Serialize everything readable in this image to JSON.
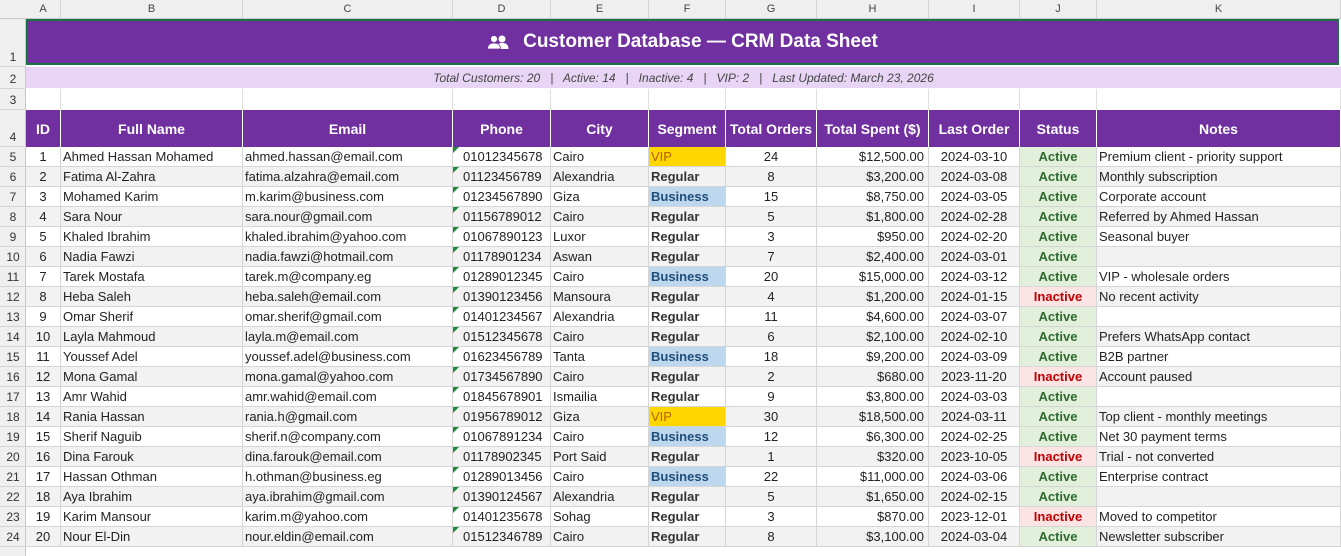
{
  "columns": [
    "A",
    "B",
    "C",
    "D",
    "E",
    "F",
    "G",
    "H",
    "I",
    "J",
    "K"
  ],
  "rows": [
    "1",
    "2",
    "3",
    "4",
    "5",
    "6",
    "7",
    "8",
    "9",
    "10",
    "11",
    "12",
    "13",
    "14",
    "15",
    "16",
    "17",
    "18",
    "19",
    "20",
    "21",
    "22",
    "23",
    "24"
  ],
  "title": "Customer Database — CRM Data Sheet",
  "title_icon": "users-icon",
  "subtitle": "Total Customers: 20   |   Active: 14   |   Inactive: 4   |   VIP: 2   |   Last Updated: March 23, 2026",
  "headers": [
    "ID",
    "Full Name",
    "Email",
    "Phone",
    "City",
    "Segment",
    "Total Orders",
    "Total Spent ($)",
    "Last Order",
    "Status",
    "Notes"
  ],
  "customers": [
    [
      "1",
      "Ahmed Hassan Mohamed",
      "ahmed.hassan@email.com",
      "01012345678",
      "Cairo",
      "VIP",
      "24",
      "$12,500.00",
      "2024-03-10",
      "Active",
      "Premium client - priority support"
    ],
    [
      "2",
      "Fatima Al-Zahra",
      "fatima.alzahra@email.com",
      "01123456789",
      "Alexandria",
      "Regular",
      "8",
      "$3,200.00",
      "2024-03-08",
      "Active",
      "Monthly subscription"
    ],
    [
      "3",
      "Mohamed Karim",
      "m.karim@business.com",
      "01234567890",
      "Giza",
      "Business",
      "15",
      "$8,750.00",
      "2024-03-05",
      "Active",
      "Corporate account"
    ],
    [
      "4",
      "Sara Nour",
      "sara.nour@gmail.com",
      "01156789012",
      "Cairo",
      "Regular",
      "5",
      "$1,800.00",
      "2024-02-28",
      "Active",
      "Referred by Ahmed Hassan"
    ],
    [
      "5",
      "Khaled Ibrahim",
      "khaled.ibrahim@yahoo.com",
      "01067890123",
      "Luxor",
      "Regular",
      "3",
      "$950.00",
      "2024-02-20",
      "Active",
      "Seasonal buyer"
    ],
    [
      "6",
      "Nadia Fawzi",
      "nadia.fawzi@hotmail.com",
      "01178901234",
      "Aswan",
      "Regular",
      "7",
      "$2,400.00",
      "2024-03-01",
      "Active",
      ""
    ],
    [
      "7",
      "Tarek Mostafa",
      "tarek.m@company.eg",
      "01289012345",
      "Cairo",
      "Business",
      "20",
      "$15,000.00",
      "2024-03-12",
      "Active",
      "VIP - wholesale orders"
    ],
    [
      "8",
      "Heba Saleh",
      "heba.saleh@email.com",
      "01390123456",
      "Mansoura",
      "Regular",
      "4",
      "$1,200.00",
      "2024-01-15",
      "Inactive",
      "No recent activity"
    ],
    [
      "9",
      "Omar Sherif",
      "omar.sherif@gmail.com",
      "01401234567",
      "Alexandria",
      "Regular",
      "11",
      "$4,600.00",
      "2024-03-07",
      "Active",
      ""
    ],
    [
      "10",
      "Layla Mahmoud",
      "layla.m@email.com",
      "01512345678",
      "Cairo",
      "Regular",
      "6",
      "$2,100.00",
      "2024-02-10",
      "Active",
      "Prefers WhatsApp contact"
    ],
    [
      "11",
      "Youssef Adel",
      "youssef.adel@business.com",
      "01623456789",
      "Tanta",
      "Business",
      "18",
      "$9,200.00",
      "2024-03-09",
      "Active",
      "B2B partner"
    ],
    [
      "12",
      "Mona Gamal",
      "mona.gamal@yahoo.com",
      "01734567890",
      "Cairo",
      "Regular",
      "2",
      "$680.00",
      "2023-11-20",
      "Inactive",
      "Account paused"
    ],
    [
      "13",
      "Amr Wahid",
      "amr.wahid@email.com",
      "01845678901",
      "Ismailia",
      "Regular",
      "9",
      "$3,800.00",
      "2024-03-03",
      "Active",
      ""
    ],
    [
      "14",
      "Rania Hassan",
      "rania.h@gmail.com",
      "01956789012",
      "Giza",
      "VIP",
      "30",
      "$18,500.00",
      "2024-03-11",
      "Active",
      "Top client - monthly meetings"
    ],
    [
      "15",
      "Sherif Naguib",
      "sherif.n@company.com",
      "01067891234",
      "Cairo",
      "Business",
      "12",
      "$6,300.00",
      "2024-02-25",
      "Active",
      "Net 30 payment terms"
    ],
    [
      "16",
      "Dina Farouk",
      "dina.farouk@email.com",
      "01178902345",
      "Port Said",
      "Regular",
      "1",
      "$320.00",
      "2023-10-05",
      "Inactive",
      "Trial - not converted"
    ],
    [
      "17",
      "Hassan Othman",
      "h.othman@business.eg",
      "01289013456",
      "Cairo",
      "Business",
      "22",
      "$11,000.00",
      "2024-03-06",
      "Active",
      "Enterprise contract"
    ],
    [
      "18",
      "Aya Ibrahim",
      "aya.ibrahim@gmail.com",
      "01390124567",
      "Alexandria",
      "Regular",
      "5",
      "$1,650.00",
      "2024-02-15",
      "Active",
      ""
    ],
    [
      "19",
      "Karim Mansour",
      "karim.m@yahoo.com",
      "01401235678",
      "Sohag",
      "Regular",
      "3",
      "$870.00",
      "2023-12-01",
      "Inactive",
      "Moved to competitor"
    ],
    [
      "20",
      "Nour El-Din",
      "nour.eldin@email.com",
      "01512346789",
      "Cairo",
      "Regular",
      "8",
      "$3,100.00",
      "2024-03-04",
      "Active",
      "Newsletter subscriber"
    ]
  ],
  "colors": {
    "header_purple": "#7030a0",
    "subtitle_lavender": "#e8d5f5",
    "vip_gold": "#ffd700",
    "business_blue": "#bdd7ee",
    "active_green": "#e2efda",
    "inactive_red": "#fde4e4",
    "selection_green": "#1e7145"
  }
}
